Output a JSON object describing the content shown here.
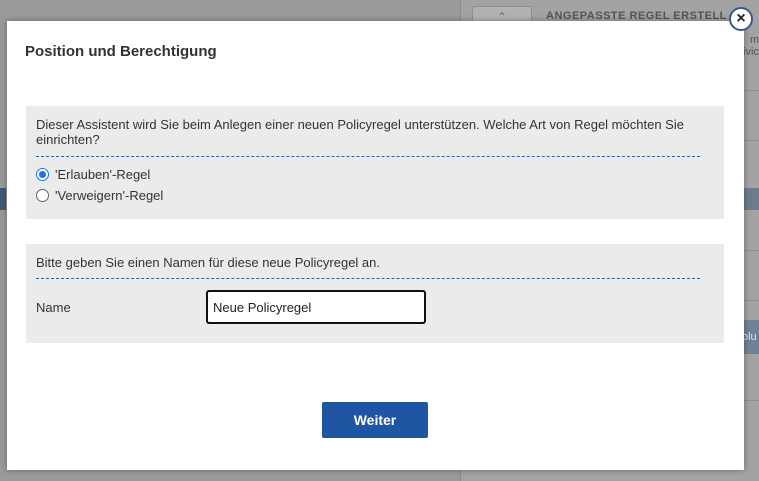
{
  "background": {
    "toolbar_button": "⌃",
    "heading": "ANGEPASSTE REGEL ERSTELL",
    "side_text_1": "m",
    "side_text_2": "ivic",
    "blue_button": "olu"
  },
  "dialog": {
    "title": "Position und Berechtigung",
    "close_label": "×",
    "rule_type": {
      "prompt": "Dieser Assistent wird Sie beim Anlegen einer neuen Policyregel unterstützen. Welche Art von Regel möchten Sie einrichten?",
      "options": [
        {
          "label": "'Erlauben'-Regel",
          "selected": true
        },
        {
          "label": "'Verweigern'-Regel",
          "selected": false
        }
      ]
    },
    "rule_name": {
      "prompt": "Bitte geben Sie einen Namen für diese neue Policyregel an.",
      "label": "Name",
      "value": "Neue Policyregel"
    },
    "next_button": "Weiter"
  },
  "colors": {
    "accent": "#1f56a4",
    "radio_selected": "#1a73e8",
    "panel_bg": "#ebebeb",
    "dash": "#3a5fa0"
  }
}
